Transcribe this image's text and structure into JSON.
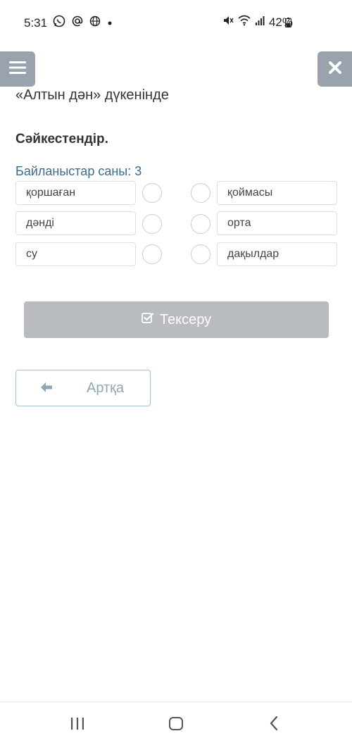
{
  "status_bar": {
    "time": "5:31",
    "left_icons": [
      "whatsapp-icon",
      "at-icon",
      "globe-icon",
      "dot-icon"
    ],
    "right_icons": [
      "mute-icon",
      "wifi-icon",
      "signal-icon"
    ],
    "battery": "42%"
  },
  "header": {
    "menu_icon": "hamburger-icon",
    "close_icon": "close-icon"
  },
  "page_title": "«Алтын дән» дүкенінде",
  "task": {
    "heading": "Сәйкестендір.",
    "connections_label": "Байланыстар саны: 3"
  },
  "left_items": [
    "қоршаған",
    "дәнді",
    "су"
  ],
  "right_items": [
    "қоймасы",
    "орта",
    "дақылдар"
  ],
  "check_button": {
    "icon": "checkbox-icon",
    "label": "Тексеру"
  },
  "back_button": {
    "icon": "arrow-left-icon",
    "label": "Артқа"
  },
  "nav_bar": {
    "icons": [
      "recent-apps-icon",
      "home-icon",
      "back-nav-icon"
    ]
  },
  "colors": {
    "header_button": "#9aa3ad",
    "connections_text": "#3d6a8f",
    "check_button_bg": "#b9bcbf",
    "back_button_border": "#9ec3d1"
  }
}
